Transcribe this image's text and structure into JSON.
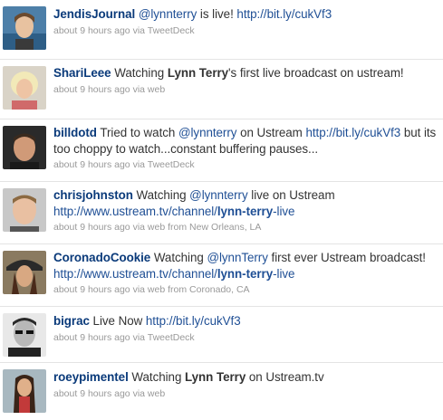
{
  "tweets": [
    {
      "user": "JendisJournal",
      "text": {
        "pre": " ",
        "mention": "@lynnterry",
        "mid": " is live! ",
        "link": "http://bit.ly/cukVf3"
      },
      "meta": {
        "time": "about 9 hours ago",
        "via": " via ",
        "source": "TweetDeck"
      }
    },
    {
      "user": "ShariLeee",
      "text": {
        "pre": " Watching ",
        "bold": "Lynn Terry",
        "post": "'s first live broadcast on ustream!"
      },
      "meta": {
        "time": "about 9 hours ago",
        "via": " via ",
        "source": "web"
      }
    },
    {
      "user": "billdotd",
      "text": {
        "pre": " Tried to watch ",
        "mention": "@lynnterry",
        "mid": " on Ustream ",
        "link": "http://bit.ly/cukVf3",
        "post": " but its too choppy to watch...constant buffering pauses..."
      },
      "meta": {
        "time": "about 9 hours ago",
        "via": " via ",
        "source": "TweetDeck"
      }
    },
    {
      "user": "chrisjohnston",
      "text": {
        "pre": " Watching ",
        "mention": "@lynnterry",
        "mid": " live on Ustream ",
        "link_a": "http://www.ustream.tv/channel/",
        "link_bold": "lynn-terry",
        "link_b": "-live"
      },
      "meta": {
        "time": "about 9 hours ago",
        "via": " via ",
        "source": "web",
        "from": " from New Orleans, LA"
      }
    },
    {
      "user": "CoronadoCookie",
      "text": {
        "pre": " Watching ",
        "mention": "@lynnTerry",
        "mid": " first ever Ustream broadcast! ",
        "link_a": "http://www.ustream.tv/channel/",
        "link_bold": "lynn-terry",
        "link_b": "-live"
      },
      "meta": {
        "time": "about 9 hours ago",
        "via": " via ",
        "source": "web",
        "from": " from Coronado, CA"
      }
    },
    {
      "user": "bigrac",
      "text": {
        "pre": " Live Now ",
        "link": "http://bit.ly/cukVf3"
      },
      "meta": {
        "time": "about 9 hours ago",
        "via": " via ",
        "source": "TweetDeck"
      }
    },
    {
      "user": "roeypimentel",
      "text": {
        "pre": " Watching ",
        "bold": "Lynn Terry",
        "post": " on Ustream.tv"
      },
      "meta": {
        "time": "about 9 hours ago",
        "via": " via ",
        "source": "web"
      }
    }
  ],
  "colors": {
    "screen_name": "#0a3a7a",
    "link": "#1f4f95",
    "meta": "#999999",
    "divider": "#e4e4e4"
  }
}
